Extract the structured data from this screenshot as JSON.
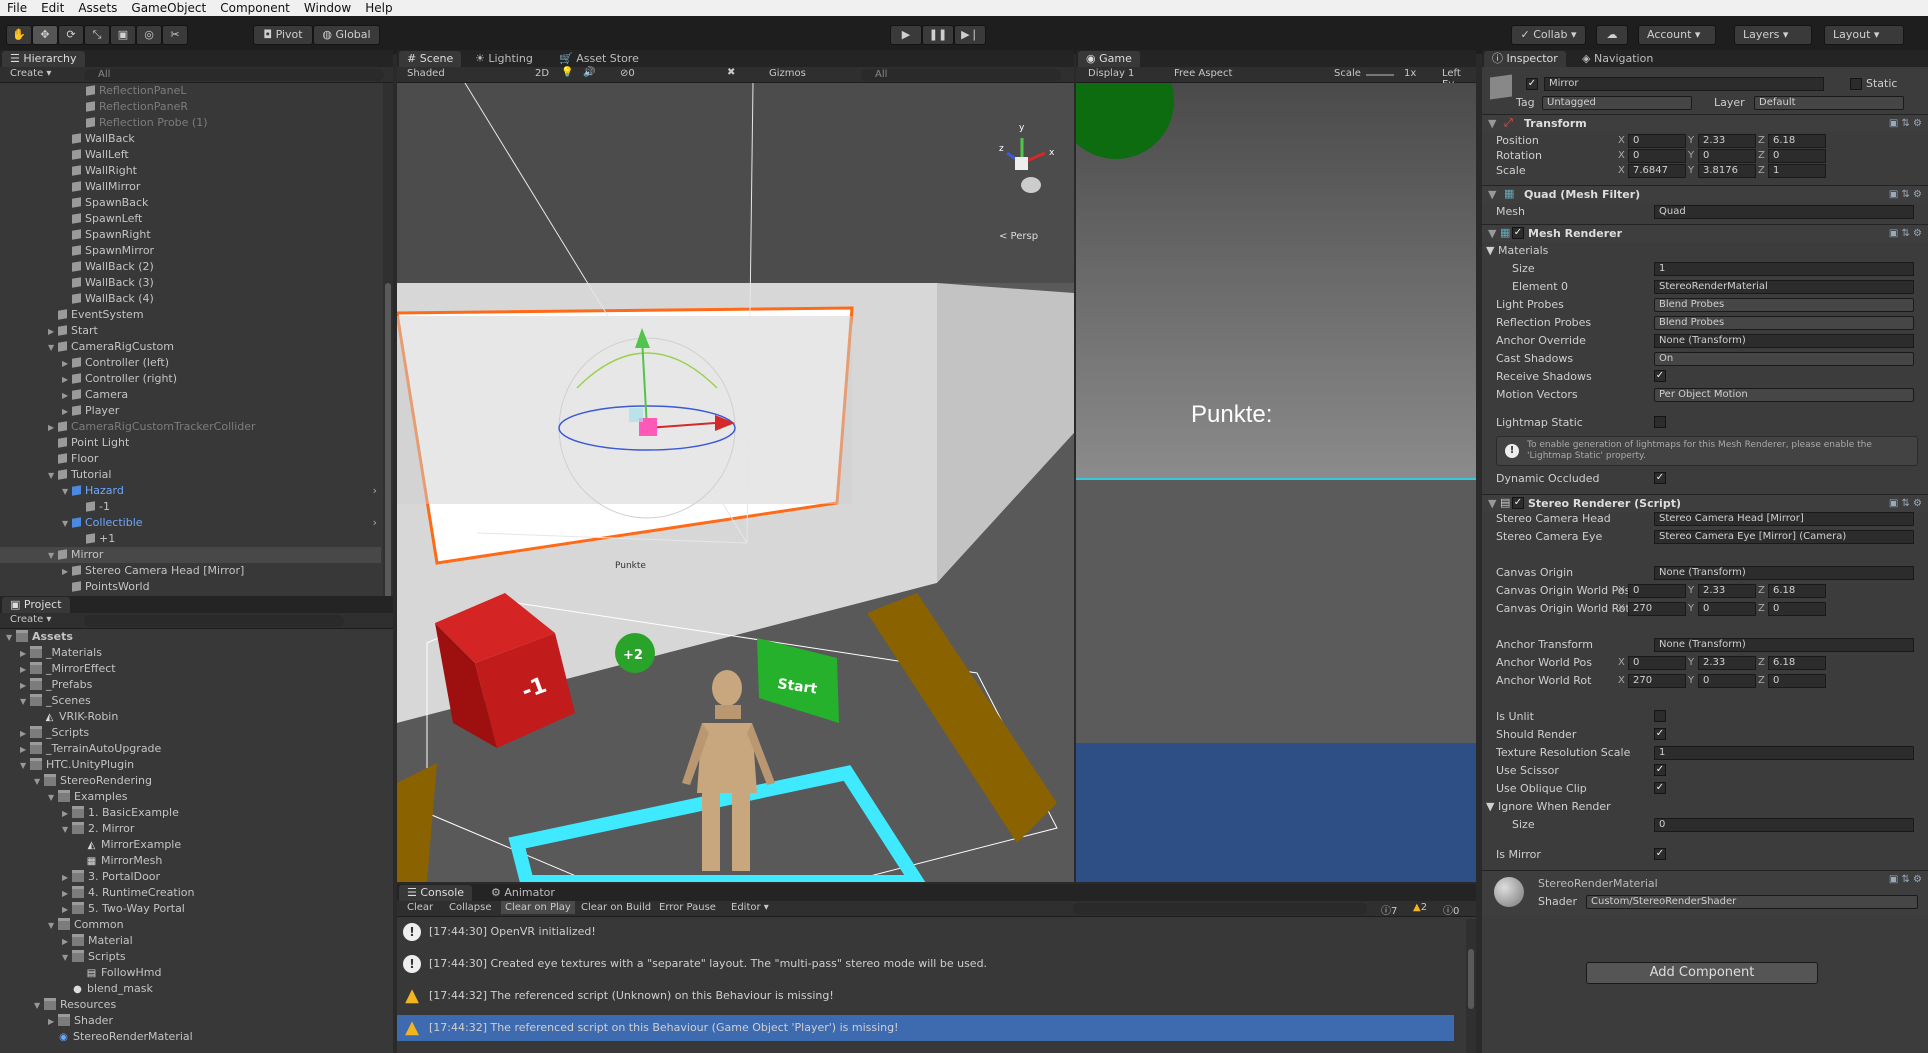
{
  "menubar": {
    "items": [
      "File",
      "Edit",
      "Assets",
      "GameObject",
      "Component",
      "Window",
      "Help"
    ]
  },
  "toolbar": {
    "pivot": "Pivot",
    "global": "Global",
    "collab": "Collab ▾",
    "account": "Account",
    "layers": "Layers",
    "layout": "Layout"
  },
  "hierarchy": {
    "tab": "Hierarchy",
    "create": "Create ▾",
    "search_placeholder": "All",
    "rows": [
      {
        "label": "ReflectionPaneL",
        "indent": 5,
        "dim": true,
        "arrow": ""
      },
      {
        "label": "ReflectionPaneR",
        "indent": 5,
        "dim": true,
        "arrow": ""
      },
      {
        "label": "Reflection Probe (1)",
        "indent": 5,
        "dim": true,
        "arrow": ""
      },
      {
        "label": "WallBack",
        "indent": 4,
        "dim": false,
        "arrow": ""
      },
      {
        "label": "WallLeft",
        "indent": 4,
        "dim": false,
        "arrow": ""
      },
      {
        "label": "WallRight",
        "indent": 4,
        "dim": false,
        "arrow": ""
      },
      {
        "label": "WallMirror",
        "indent": 4,
        "dim": false,
        "arrow": ""
      },
      {
        "label": "SpawnBack",
        "indent": 4,
        "dim": false,
        "arrow": ""
      },
      {
        "label": "SpawnLeft",
        "indent": 4,
        "dim": false,
        "arrow": ""
      },
      {
        "label": "SpawnRight",
        "indent": 4,
        "dim": false,
        "arrow": ""
      },
      {
        "label": "SpawnMirror",
        "indent": 4,
        "dim": false,
        "arrow": ""
      },
      {
        "label": "WallBack (2)",
        "indent": 4,
        "dim": false,
        "arrow": ""
      },
      {
        "label": "WallBack (3)",
        "indent": 4,
        "dim": false,
        "arrow": ""
      },
      {
        "label": "WallBack (4)",
        "indent": 4,
        "dim": false,
        "arrow": ""
      },
      {
        "label": "EventSystem",
        "indent": 3,
        "dim": false,
        "arrow": ""
      },
      {
        "label": "Start",
        "indent": 3,
        "dim": false,
        "arrow": "▶"
      },
      {
        "label": "CameraRigCustom",
        "indent": 3,
        "dim": false,
        "arrow": "▼"
      },
      {
        "label": "Controller (left)",
        "indent": 4,
        "dim": false,
        "arrow": "▶"
      },
      {
        "label": "Controller (right)",
        "indent": 4,
        "dim": false,
        "arrow": "▶"
      },
      {
        "label": "Camera",
        "indent": 4,
        "dim": false,
        "arrow": "▶"
      },
      {
        "label": "Player",
        "indent": 4,
        "dim": false,
        "arrow": "▶"
      },
      {
        "label": "CameraRigCustomTrackerCollider",
        "indent": 3,
        "dim": true,
        "arrow": "▶"
      },
      {
        "label": "Point Light",
        "indent": 3,
        "dim": false,
        "arrow": ""
      },
      {
        "label": "Floor",
        "indent": 3,
        "dim": false,
        "arrow": ""
      },
      {
        "label": "Tutorial",
        "indent": 3,
        "dim": false,
        "arrow": "▼"
      },
      {
        "label": "Hazard",
        "indent": 4,
        "dim": false,
        "arrow": "▼",
        "blue": true
      },
      {
        "label": "-1",
        "indent": 5,
        "dim": false,
        "arrow": ""
      },
      {
        "label": "Collectible",
        "indent": 4,
        "dim": false,
        "arrow": "▼",
        "blue": true
      },
      {
        "label": "+1",
        "indent": 5,
        "dim": false,
        "arrow": ""
      },
      {
        "label": "Mirror",
        "indent": 3,
        "dim": false,
        "arrow": "▼",
        "selected": true
      },
      {
        "label": "Stereo Camera Head [Mirror]",
        "indent": 4,
        "dim": false,
        "arrow": "▶"
      },
      {
        "label": "PointsWorld",
        "indent": 4,
        "dim": false,
        "arrow": ""
      }
    ]
  },
  "project": {
    "tab": "Project",
    "create": "Create ▾",
    "rows": [
      {
        "label": "Assets",
        "indent": 0,
        "arrow": "▼",
        "type": "folder",
        "bold": true
      },
      {
        "label": "_Materials",
        "indent": 1,
        "arrow": "▶",
        "type": "folder"
      },
      {
        "label": "_MirrorEffect",
        "indent": 1,
        "arrow": "▶",
        "type": "folder"
      },
      {
        "label": "_Prefabs",
        "indent": 1,
        "arrow": "▶",
        "type": "folder"
      },
      {
        "label": "_Scenes",
        "indent": 1,
        "arrow": "▼",
        "type": "folder"
      },
      {
        "label": "VRIK-Robin",
        "indent": 2,
        "arrow": "",
        "type": "unity"
      },
      {
        "label": "_Scripts",
        "indent": 1,
        "arrow": "▶",
        "type": "folder"
      },
      {
        "label": "_TerrainAutoUpgrade",
        "indent": 1,
        "arrow": "▶",
        "type": "folder"
      },
      {
        "label": "HTC.UnityPlugin",
        "indent": 1,
        "arrow": "▼",
        "type": "folder"
      },
      {
        "label": "StereoRendering",
        "indent": 2,
        "arrow": "▼",
        "type": "folder"
      },
      {
        "label": "Examples",
        "indent": 3,
        "arrow": "▼",
        "type": "folder"
      },
      {
        "label": "1. BasicExample",
        "indent": 4,
        "arrow": "▶",
        "type": "folder"
      },
      {
        "label": "2. Mirror",
        "indent": 4,
        "arrow": "▼",
        "type": "folder"
      },
      {
        "label": "MirrorExample",
        "indent": 5,
        "arrow": "",
        "type": "unity"
      },
      {
        "label": "MirrorMesh",
        "indent": 5,
        "arrow": "",
        "type": "grid"
      },
      {
        "label": "3. PortalDoor",
        "indent": 4,
        "arrow": "▶",
        "type": "folder"
      },
      {
        "label": "4. RuntimeCreation",
        "indent": 4,
        "arrow": "▶",
        "type": "folder"
      },
      {
        "label": "5. Two-Way Portal",
        "indent": 4,
        "arrow": "▶",
        "type": "folder"
      },
      {
        "label": "Common",
        "indent": 3,
        "arrow": "▼",
        "type": "folder"
      },
      {
        "label": "Material",
        "indent": 4,
        "arrow": "▶",
        "type": "folder"
      },
      {
        "label": "Scripts",
        "indent": 4,
        "arrow": "▼",
        "type": "folder"
      },
      {
        "label": "FollowHmd",
        "indent": 5,
        "arrow": "",
        "type": "script"
      },
      {
        "label": "blend_mask",
        "indent": 4,
        "arrow": "",
        "type": "ball"
      },
      {
        "label": "Resources",
        "indent": 2,
        "arrow": "▼",
        "type": "folder"
      },
      {
        "label": "Shader",
        "indent": 3,
        "arrow": "▶",
        "type": "folder"
      },
      {
        "label": "StereoRenderMaterial",
        "indent": 3,
        "arrow": "",
        "type": "mat"
      }
    ]
  },
  "scene": {
    "tabs": [
      "Scene",
      "Lighting",
      "Asset Store"
    ],
    "shading": "Shaded",
    "mode2d": "2D",
    "layers_count": "0",
    "gizmos": "Gizmos",
    "search_placeholder": "All",
    "persp": "< Persp",
    "punkte_small": "Punkte",
    "cube_label": "-1",
    "ball_label": "+2",
    "start_label": "Start"
  },
  "game": {
    "tab": "Game",
    "display": "Display 1",
    "aspect": "Free Aspect",
    "scale_label": "Scale",
    "scale_value": "1x",
    "eye": "Left Ey",
    "punkte": "Punkte:"
  },
  "console": {
    "tabs": [
      "Console",
      "Animator"
    ],
    "buttons": [
      "Clear",
      "Collapse",
      "Clear on Play",
      "Clear on Build",
      "Error Pause",
      "Editor ▾"
    ],
    "count_info": "7",
    "count_warn": "2",
    "count_err": "0",
    "rows": [
      {
        "type": "info",
        "text": "[17:44:30] OpenVR initialized!"
      },
      {
        "type": "info",
        "text": "[17:44:30] Created eye textures with a \"separate\" layout.  The \"multi-pass\" stereo mode will be used."
      },
      {
        "type": "warn",
        "text": "[17:44:32] The referenced script (Unknown) on this Behaviour is missing!"
      },
      {
        "type": "warn",
        "text": "[17:44:32] The referenced script on this Behaviour (Game Object 'Player') is missing!",
        "selected": true
      }
    ]
  },
  "inspector": {
    "tabs": [
      "Inspector",
      "Navigation"
    ],
    "name": "Mirror",
    "static_label": "Static",
    "tag_label": "Tag",
    "tag_value": "Untagged",
    "layer_label": "Layer",
    "layer_value": "Default",
    "transform": {
      "title": "Transform",
      "position_label": "Position",
      "position": [
        "0",
        "2.33",
        "6.18"
      ],
      "rotation_label": "Rotation",
      "rotation": [
        "0",
        "0",
        "0"
      ],
      "scale_label": "Scale",
      "scale": [
        "7.6847",
        "3.8176",
        "1"
      ]
    },
    "mesh_filter": {
      "title": "Quad (Mesh Filter)",
      "mesh_label": "Mesh",
      "mesh_value": "Quad"
    },
    "mesh_renderer": {
      "title": "Mesh Renderer",
      "materials_label": "Materials",
      "size_label": "Size",
      "size_value": "1",
      "element0_label": "Element 0",
      "element0_value": "StereoRenderMaterial",
      "light_probes_label": "Light Probes",
      "light_probes_value": "Blend Probes",
      "reflection_probes_label": "Reflection Probes",
      "reflection_probes_value": "Blend Probes",
      "anchor_override_label": "Anchor Override",
      "anchor_override_value": "None (Transform)",
      "cast_shadows_label": "Cast Shadows",
      "cast_shadows_value": "On",
      "receive_shadows_label": "Receive Shadows",
      "motion_vectors_label": "Motion Vectors",
      "motion_vectors_value": "Per Object Motion",
      "lightmap_static_label": "Lightmap Static",
      "info": "To enable generation of lightmaps for this Mesh Renderer, please enable the 'Lightmap Static' property.",
      "dynamic_occluded_label": "Dynamic Occluded"
    },
    "stereo_renderer": {
      "title": "Stereo Renderer (Script)",
      "head_label": "Stereo Camera Head",
      "head_value": "Stereo Camera Head [Mirror]",
      "eye_label": "Stereo Camera Eye",
      "eye_value": "Stereo Camera Eye [Mirror] (Camera)",
      "canvas_origin_label": "Canvas Origin",
      "canvas_origin_value": "None (Transform)",
      "canvas_pos_label": "Canvas Origin World Pos",
      "canvas_pos": [
        "0",
        "2.33",
        "6.18"
      ],
      "canvas_rot_label": "Canvas Origin World Rot",
      "canvas_rot": [
        "270",
        "0",
        "0"
      ],
      "anchor_transform_label": "Anchor Transform",
      "anchor_transform_value": "None (Transform)",
      "anchor_pos_label": "Anchor World Pos",
      "anchor_pos": [
        "0",
        "2.33",
        "6.18"
      ],
      "anchor_rot_label": "Anchor World Rot",
      "anchor_rot": [
        "270",
        "0",
        "0"
      ],
      "is_unlit_label": "Is Unlit",
      "should_render_label": "Should Render",
      "tex_res_label": "Texture Resolution Scale",
      "tex_res_value": "1",
      "use_scissor_label": "Use Scissor",
      "use_oblique_label": "Use Oblique Clip",
      "ignore_label": "Ignore When Render",
      "ignore_size_label": "Size",
      "ignore_size_value": "0",
      "is_mirror_label": "Is Mirror"
    },
    "material": {
      "name": "StereoRenderMaterial",
      "shader_label": "Shader",
      "shader_value": "Custom/StereoRenderShader"
    },
    "add_component": "Add Component"
  }
}
